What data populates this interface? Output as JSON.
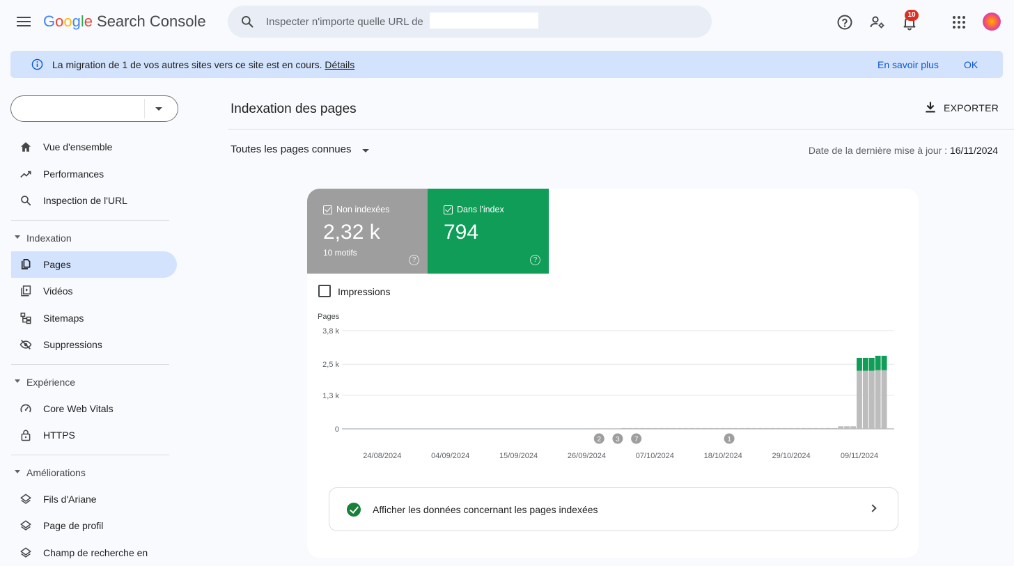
{
  "app": {
    "logo_google": "Google",
    "logo_product": "Search Console"
  },
  "search": {
    "placeholder": "Inspecter n'importe quelle URL de"
  },
  "topbar": {
    "notifications_count": "10"
  },
  "banner": {
    "message": "La migration de 1 de vos autres sites vers ce site est en cours.",
    "details_link": "Détails",
    "learn_more": "En savoir plus",
    "ok": "OK"
  },
  "sidebar": {
    "top_items": [
      {
        "label": "Vue d'ensemble",
        "icon": "home-icon"
      },
      {
        "label": "Performances",
        "icon": "trending-up-icon"
      },
      {
        "label": "Inspection de l'URL",
        "icon": "search-icon"
      }
    ],
    "groups": [
      {
        "label": "Indexation",
        "items": [
          {
            "label": "Pages",
            "icon": "pages-icon",
            "active": true
          },
          {
            "label": "Vidéos",
            "icon": "video-icon"
          },
          {
            "label": "Sitemaps",
            "icon": "sitemap-icon"
          },
          {
            "label": "Suppressions",
            "icon": "eye-off-icon"
          }
        ]
      },
      {
        "label": "Expérience",
        "items": [
          {
            "label": "Core Web Vitals",
            "icon": "gauge-icon"
          },
          {
            "label": "HTTPS",
            "icon": "lock-icon"
          }
        ]
      },
      {
        "label": "Améliorations",
        "items": [
          {
            "label": "Fils d'Ariane",
            "icon": "layers-icon"
          },
          {
            "label": "Page de profil",
            "icon": "layers-icon"
          },
          {
            "label": "Champ de recherche en",
            "icon": "layers-icon"
          }
        ]
      }
    ]
  },
  "main": {
    "title": "Indexation des pages",
    "export_label": "EXPORTER",
    "filter_label": "Toutes les pages connues",
    "updated_label": "Date de la dernière mise à jour :",
    "updated_date": "16/11/2024"
  },
  "stats": {
    "not_indexed": {
      "label": "Non indexées",
      "value": "2,32 k",
      "sub": "10 motifs"
    },
    "indexed": {
      "label": "Dans l'index",
      "value": "794"
    }
  },
  "impressions_label": "Impressions",
  "cta_label": "Afficher les données concernant les pages indexées",
  "colors": {
    "not_indexed": "#bdbdbd",
    "indexed": "#0f9d58",
    "annotation": "#9e9e9e"
  },
  "chart_data": {
    "type": "bar",
    "stacked": true,
    "ylabel": "Pages",
    "yticks": [
      "3,8 k",
      "2,5 k",
      "1,3 k",
      "0"
    ],
    "ylim": [
      0,
      3800
    ],
    "xticks": [
      "24/08/2024",
      "04/09/2024",
      "15/09/2024",
      "26/09/2024",
      "07/10/2024",
      "18/10/2024",
      "29/10/2024",
      "09/11/2024"
    ],
    "x_start": "2024-08-18",
    "days": 88,
    "series": [
      {
        "name": "Non indexées",
        "values": [
          0,
          0,
          0,
          0,
          0,
          0,
          0,
          0,
          0,
          0,
          0,
          0,
          0,
          0,
          0,
          0,
          0,
          0,
          0,
          0,
          0,
          0,
          0,
          0,
          0,
          0,
          0,
          0,
          0,
          0,
          0,
          0,
          0,
          0,
          0,
          0,
          0,
          0,
          0,
          0,
          20,
          20,
          20,
          20,
          20,
          30,
          30,
          30,
          30,
          30,
          30,
          30,
          30,
          30,
          30,
          30,
          30,
          30,
          30,
          30,
          30,
          30,
          30,
          30,
          30,
          30,
          30,
          30,
          30,
          30,
          30,
          30,
          30,
          30,
          30,
          30,
          30,
          30,
          30,
          30,
          100,
          100,
          100,
          2250,
          2250,
          2250,
          2270,
          2270,
          2270,
          2270,
          2260,
          2260,
          2260,
          2260,
          2270,
          2270,
          2270,
          2270,
          2270,
          2280,
          2280,
          2280,
          2280,
          2280,
          2300,
          2300,
          2300,
          2300,
          2300,
          2310,
          2310,
          2310,
          2310,
          2320,
          2320,
          2320,
          2320,
          2320,
          2320
        ]
      },
      {
        "name": "Dans l'index",
        "values": [
          0,
          0,
          0,
          0,
          0,
          0,
          0,
          0,
          0,
          0,
          0,
          0,
          0,
          0,
          0,
          0,
          0,
          0,
          0,
          0,
          0,
          0,
          0,
          0,
          0,
          0,
          0,
          0,
          0,
          0,
          0,
          0,
          0,
          0,
          0,
          0,
          0,
          0,
          0,
          0,
          0,
          0,
          0,
          0,
          0,
          0,
          0,
          0,
          0,
          0,
          0,
          0,
          0,
          0,
          0,
          0,
          0,
          0,
          0,
          0,
          0,
          0,
          0,
          0,
          0,
          0,
          0,
          0,
          0,
          0,
          0,
          0,
          0,
          0,
          0,
          0,
          0,
          0,
          0,
          0,
          0,
          0,
          0,
          500,
          500,
          500,
          560,
          560,
          560,
          600,
          620,
          620,
          620,
          640,
          660,
          660,
          680,
          700,
          700,
          700,
          710,
          710,
          720,
          720,
          730,
          730,
          740,
          740,
          740,
          750,
          750,
          760,
          760,
          770,
          770,
          780,
          780,
          790,
          794
        ]
      }
    ],
    "annotations": [
      {
        "label": "2",
        "date": "2024-09-28"
      },
      {
        "label": "3",
        "date": "2024-10-01"
      },
      {
        "label": "7",
        "date": "2024-10-04"
      },
      {
        "label": "1",
        "date": "2024-10-19"
      }
    ],
    "grid": true,
    "legend": "none"
  }
}
